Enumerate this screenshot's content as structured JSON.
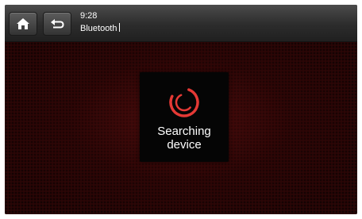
{
  "status_bar": {
    "time": "9:28",
    "title": "Bluetooth"
  },
  "navigation": {
    "home_icon": "home-icon",
    "back_icon": "back-arrow-icon"
  },
  "dialog": {
    "line1": "Searching",
    "line2": "device",
    "spinner_icon": "spinner-icon"
  },
  "colors": {
    "accent": "#e53935",
    "background": "#2a0606",
    "top_bar": "#2c2c2c"
  }
}
